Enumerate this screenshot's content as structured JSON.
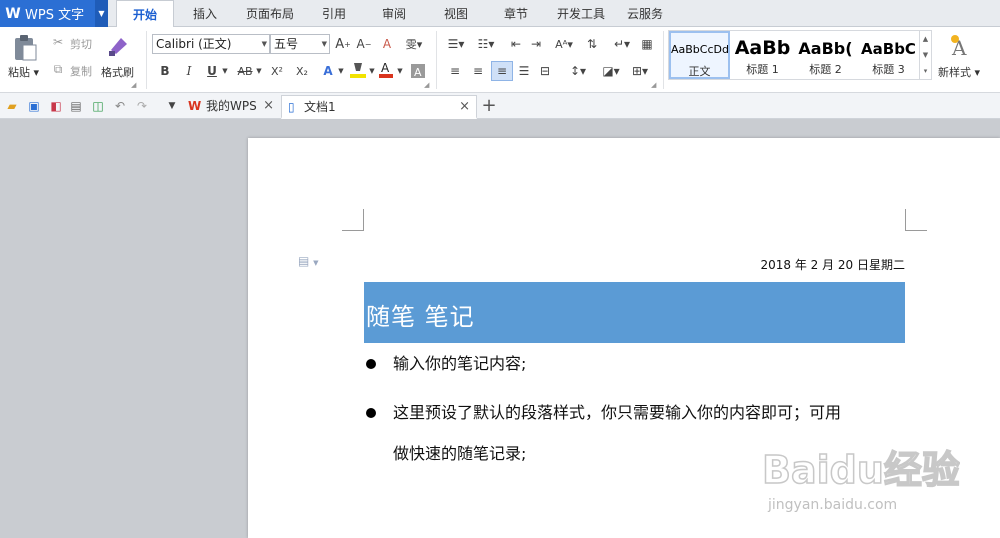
{
  "app": {
    "name": "WPS 文字",
    "logo": "W"
  },
  "menu_tabs": [
    "开始",
    "插入",
    "页面布局",
    "引用",
    "审阅",
    "视图",
    "章节",
    "开发工具",
    "云服务"
  ],
  "ribbon": {
    "paste": "粘贴",
    "cut": "剪切",
    "copy": "复制",
    "format_painter": "格式刷",
    "font_name": "Calibri (正文)",
    "font_size": "五号",
    "superscript": "X²",
    "subscript": "X₂",
    "bold": "B",
    "italic": "I",
    "underline": "U",
    "strike": "AB",
    "styles": [
      {
        "sample": "AaBbCcDd",
        "name": "正文"
      },
      {
        "sample": "AaBb",
        "name": "标题 1"
      },
      {
        "sample": "AaBb(",
        "name": "标题 2"
      },
      {
        "sample": "AaBbC",
        "name": "标题 3"
      }
    ],
    "new_style": "新样式"
  },
  "doc_tabs": [
    {
      "label": "我的WPS"
    },
    {
      "label": "文档1"
    }
  ],
  "document": {
    "date": "2018 年 2 月 20 日星期二",
    "title": "随笔  笔记",
    "bullets": [
      "输入你的笔记内容;",
      "这里预设了默认的段落样式，你只需要输入你的内容即可；可用"
    ],
    "continuation": "做快速的随笔记录;"
  },
  "watermark": {
    "brand": "Baidu经验",
    "url": "jingyan.baidu.com"
  },
  "colors": {
    "accent": "#2b6fd4",
    "banner": "#5b9bd5",
    "highlight": "#f2e300",
    "font_red": "#d9341e"
  }
}
